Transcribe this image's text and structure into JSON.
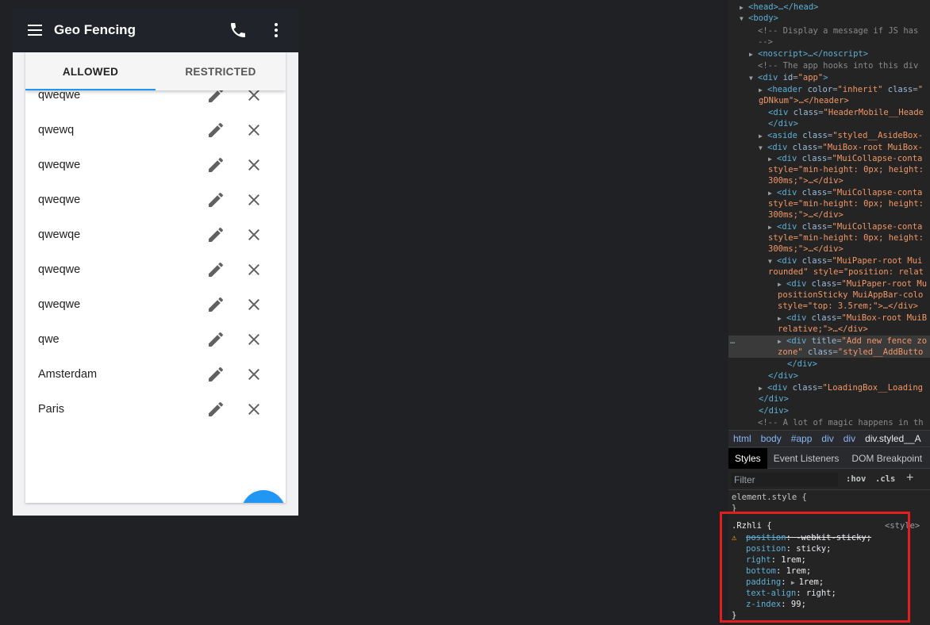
{
  "app": {
    "title": "Geo Fencing",
    "tabs": [
      {
        "label": "ALLOWED",
        "active": true
      },
      {
        "label": "RESTRICTED",
        "active": false
      }
    ],
    "fences": [
      "qweqwe",
      "qwewq",
      "qweqwe",
      "qweqwe",
      "qwewqe",
      "qweqwe",
      "qweqwe",
      "qwe",
      "Amsterdam",
      "Paris"
    ],
    "fab_icon": "plus-icon",
    "colors": {
      "appbar": "#20232a",
      "accent": "#2196f3",
      "background": "#f2f2f5"
    }
  },
  "devtools": {
    "dom": {
      "l0": "<head>…</head>",
      "l1": "<body>",
      "l2": "<!-- Display a message if JS has",
      "l3": "-->",
      "l4": "<noscript>…</noscript>",
      "l5": "<!-- The app hooks into this div",
      "l6_tag": "<div ",
      "l6_attr": "id",
      "l6_val": "\"app\"",
      "l7_tag": "<header ",
      "l7_attr1": "color",
      "l7_val1": "\"inherit\"",
      "l7_attr2": " class",
      "l7_val2": "\"",
      "l8": "gDNkum\">…</header>",
      "l9_tag": "<div ",
      "l9_attr": "class",
      "l9_val": "\"HeaderMobile__Heade",
      "l10": "</div>",
      "l11_tag": "<aside ",
      "l11_attr": "class",
      "l11_val": "\"styled__AsideBox-",
      "l12_tag": "<div ",
      "l12_attr": "class",
      "l12_val": "\"MuiBox-root MuiBox-",
      "l13_tag": "<div ",
      "l13_attr": "class",
      "l13_val": "\"MuiCollapse-conta",
      "l14": "style=\"min-height: 0px; height:",
      "l15": "300ms;\">…</div>",
      "l16_tag": "<div ",
      "l16_attr": "class",
      "l16_val": "\"MuiCollapse-conta",
      "l17": "style=\"min-height: 0px; height:",
      "l18": "300ms;\">…</div>",
      "l19_tag": "<div ",
      "l19_attr": "class",
      "l19_val": "\"MuiCollapse-conta",
      "l20": "style=\"min-height: 0px; height:",
      "l21": "300ms;\">…</div>",
      "l22_tag": "<div ",
      "l22_attr": "class",
      "l22_val": "\"MuiPaper-root Mui",
      "l23": "rounded\" style=\"position: relat",
      "l24_tag": "<div ",
      "l24_attr": "class",
      "l24_val": "\"MuiPaper-root Mu",
      "l25": "positionSticky MuiAppBar-colo",
      "l26": "style=\"top: 3.5rem;\">…</div>",
      "l27_tag": "<div ",
      "l27_attr": "class",
      "l27_val": "\"MuiBox-root MuiB",
      "l28": "relative;\">…</div>",
      "l29_tag": "<div ",
      "l29_attr": "title",
      "l29_val": "\"Add new fence zo",
      "l30_a": "zone\"",
      "l30_attr": " class",
      "l30_val": "\"styled__AddButto",
      "l31": "</div>",
      "l32": "</div>",
      "l33_tag": "<div ",
      "l33_attr": "class",
      "l33_val": "\"LoadingBox__Loading",
      "l34": "</div>",
      "l35": "</div>",
      "l36": "<!-- A lot of magic happens in th",
      "dots": "…"
    },
    "breadcrumb": [
      "html",
      "body",
      "#app",
      "div",
      "div",
      "div.styled__A"
    ],
    "subtabs": [
      "Styles",
      "Event Listeners",
      "DOM Breakpoint"
    ],
    "filter": {
      "placeholder": "Filter",
      "hov": ":hov",
      "cls": ".cls",
      "add": "+"
    },
    "element_style": {
      "selector": "element.style {",
      "close": "}"
    },
    "rule": {
      "selector": ".Rzhli {",
      "source": "<style>",
      "warning_icon": "warning-icon",
      "props": [
        {
          "name": "position",
          "value": "-webkit-sticky;",
          "struck": true
        },
        {
          "name": "position",
          "value": "sticky;",
          "struck": false
        },
        {
          "name": "right",
          "value": "1rem;",
          "struck": false
        },
        {
          "name": "bottom",
          "value": "1rem;",
          "struck": false
        },
        {
          "name": "padding",
          "value": "1rem;",
          "struck": false
        },
        {
          "name": "text-align",
          "value": "right;",
          "struck": false
        },
        {
          "name": "z-index",
          "value": "99;",
          "struck": false
        }
      ],
      "close": "}"
    },
    "highlight_color": "#e41e1e"
  }
}
